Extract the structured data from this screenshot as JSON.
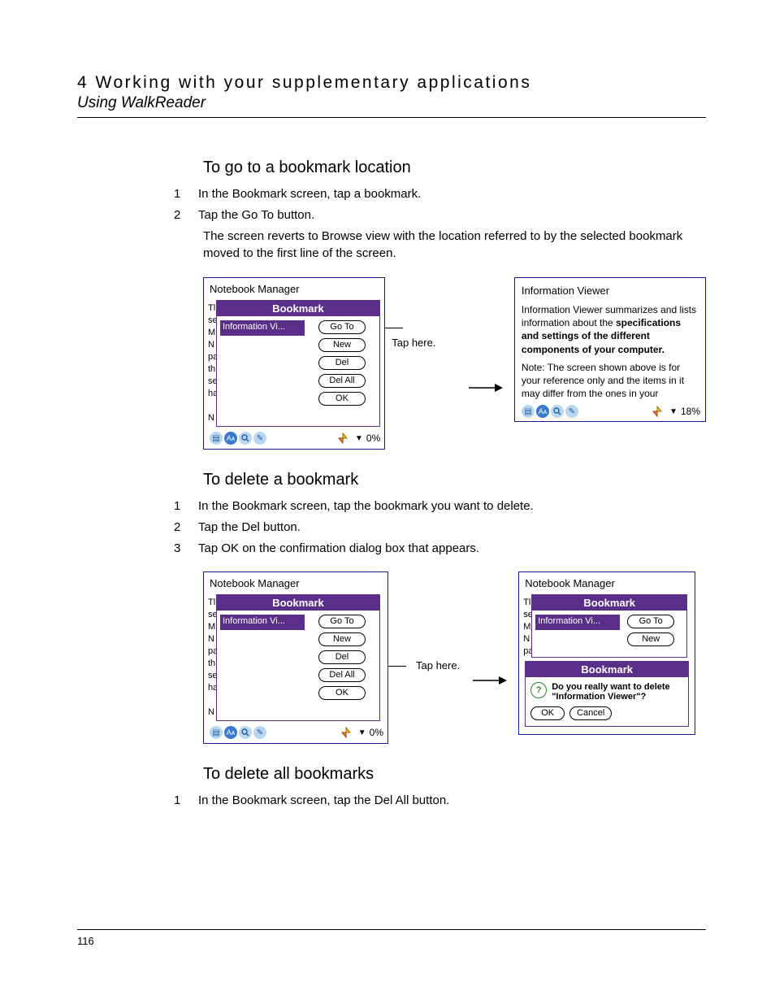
{
  "hdr": {
    "chapter": "4 Working with your supplementary applications",
    "section": "Using WalkReader"
  },
  "s1": {
    "h": "To go to a bookmark location",
    "steps": [
      "In the Bookmark screen, tap a bookmark.",
      "Tap the Go To button."
    ],
    "note": "The screen reverts to Browse view with the location referred to by the selected bookmark moved to the first line of the screen.",
    "annot": "Tap here."
  },
  "s2": {
    "h": "To delete a bookmark",
    "steps": [
      "In the Bookmark screen, tap the bookmark you want to delete.",
      "Tap the Del button.",
      "Tap OK on the confirmation dialog box that appears."
    ],
    "annot": "Tap here."
  },
  "s3": {
    "h": "To delete all bookmarks",
    "steps": [
      "In the Bookmark screen, tap the Del All button."
    ]
  },
  "shot": {
    "title": "Notebook Manager",
    "panel": "Bookmark",
    "item": "Information Vi...",
    "btns": {
      "goto": "Go To",
      "new": "New",
      "del": "Del",
      "delall": "Del All",
      "ok": "OK"
    },
    "pct0": "0%",
    "pct18": "18%",
    "bg": "Tl\nse\nM\nN\npa\nth\nse\nha\n\nN",
    "bg2": "Tl\nse\nM\nN\npa"
  },
  "info": {
    "title": "Information Viewer",
    "body": "Information Viewer summarizes and lists information about the ",
    "bold1": "specifications and settings of the different components of your computer.",
    "note": "Note: The screen shown above is for your reference only and the items in it may differ from the ones in your"
  },
  "confirm": {
    "hdr": "Bookmark",
    "msg": "Do you really want to delete \"Information Viewer\"?",
    "ok": "OK",
    "cancel": "Cancel"
  },
  "page": "116"
}
